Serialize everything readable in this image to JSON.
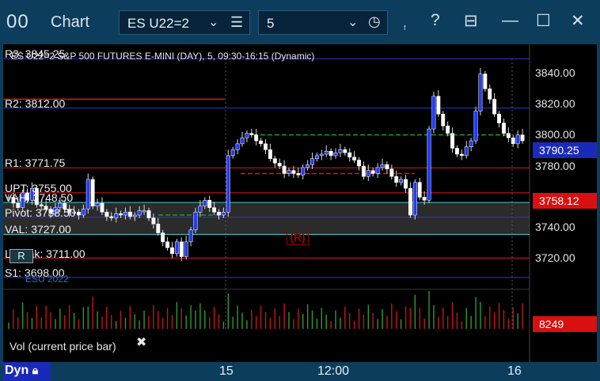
{
  "window": {
    "app_icon": "00",
    "title": "Chart",
    "symbol": "ES U22=2",
    "interval": "5"
  },
  "toolbar": {
    "link_icon": "ᶠ",
    "help": "?",
    "menu_icon": "⊟",
    "minimize": "—",
    "maximize": "☐",
    "close": "✕"
  },
  "chart": {
    "header": "ES U22=2 S&P 500 FUTURES E-MINI (DAY), 5, 09:30-16:15 (Dynamic)",
    "levels": [
      {
        "label": "R3: 3845.25",
        "value": 3845.25
      },
      {
        "label": "R2: 3812.00",
        "value": 3812.0
      },
      {
        "label": "R1: 3771.75",
        "value": 3771.75
      },
      {
        "label": "UPT: 3755.00",
        "value": 3755.0
      },
      {
        "label": "VAH: 3748.50",
        "value": 3748.5
      },
      {
        "label": "Pivot: 3738.50",
        "value": 3738.5
      },
      {
        "label": "VAL: 3727.00",
        "value": 3727.0
      },
      {
        "label": "LBreak: 3711.00",
        "value": 3711.0
      },
      {
        "label": "S1: 3698.00",
        "value": 3698.0
      }
    ],
    "date_watermark": "ESU 2022",
    "r_marker": "(R)",
    "r_badge": "R",
    "colors": {
      "background": "#000000",
      "candle": "#1f3bff",
      "r2_line": "#2a3ad0",
      "red_line": "#e01818",
      "cyan_line": "#40d0d0",
      "green_dashed": "#1aa01a",
      "value_area": "#2b2b2b"
    }
  },
  "axis": {
    "y_ticks": [
      "3840.00",
      "3820.00",
      "3800.00",
      "3780.00",
      "3740.00",
      "3720.00"
    ],
    "last_price": "3790.25",
    "red_price": "3758.12",
    "x_ticks": [
      "15",
      "12:00",
      "16"
    ]
  },
  "volume": {
    "legend": "Vol (current price bar)",
    "value": "8249",
    "close_icon": "✖"
  },
  "footer": {
    "mode": "Dyn",
    "lock_icon": "🔒"
  },
  "chart_data": {
    "type": "candlestick",
    "ylim": [
      3690,
      3855
    ],
    "closes": [
      3752,
      3748,
      3745,
      3755,
      3750,
      3758,
      3747,
      3746,
      3744,
      3741,
      3745,
      3748,
      3744,
      3742,
      3742,
      3740,
      3744,
      3764,
      3746,
      3748,
      3742,
      3739,
      3738,
      3741,
      3740,
      3742,
      3739,
      3740,
      3743,
      3743,
      3738,
      3734,
      3728,
      3722,
      3718,
      3714,
      3722,
      3712,
      3722,
      3730,
      3742,
      3746,
      3750,
      3745,
      3742,
      3740,
      3742,
      3780,
      3784,
      3788,
      3792,
      3795,
      3794,
      3790,
      3788,
      3784,
      3778,
      3775,
      3773,
      3768,
      3770,
      3768,
      3767,
      3772,
      3774,
      3778,
      3780,
      3781,
      3783,
      3780,
      3782,
      3784,
      3782,
      3779,
      3777,
      3773,
      3766,
      3770,
      3768,
      3772,
      3774,
      3771,
      3766,
      3762,
      3764,
      3758,
      3740,
      3762,
      3752,
      3750,
      3798,
      3820,
      3808,
      3800,
      3795,
      3785,
      3781,
      3780,
      3786,
      3790,
      3810,
      3835,
      3825,
      3818,
      3808,
      3802,
      3795,
      3792,
      3788,
      3794,
      3790
    ]
  }
}
